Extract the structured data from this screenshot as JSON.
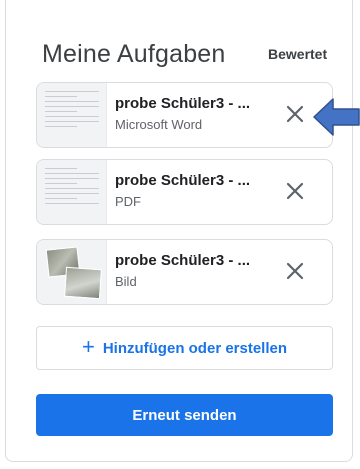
{
  "header": {
    "title": "Meine Aufgaben",
    "status": "Bewertet"
  },
  "attachments": [
    {
      "name": "probe Schüler3 - ...",
      "type": "Microsoft Word",
      "thumbnail_icon": "document-thumbnail"
    },
    {
      "name": "probe Schüler3 - ...",
      "type": "PDF",
      "thumbnail_icon": "document-thumbnail"
    },
    {
      "name": "probe Schüler3 - ...",
      "type": "Bild",
      "thumbnail_icon": "image-thumbnail"
    }
  ],
  "actions": {
    "add_label": "Hinzufügen oder erstellen",
    "resend_label": "Erneut senden"
  },
  "icons": {
    "remove": "close-icon",
    "add": "plus-icon",
    "annotation": "arrow-left-icon"
  },
  "colors": {
    "accent": "#1a73e8",
    "arrow": "#4472c4"
  }
}
